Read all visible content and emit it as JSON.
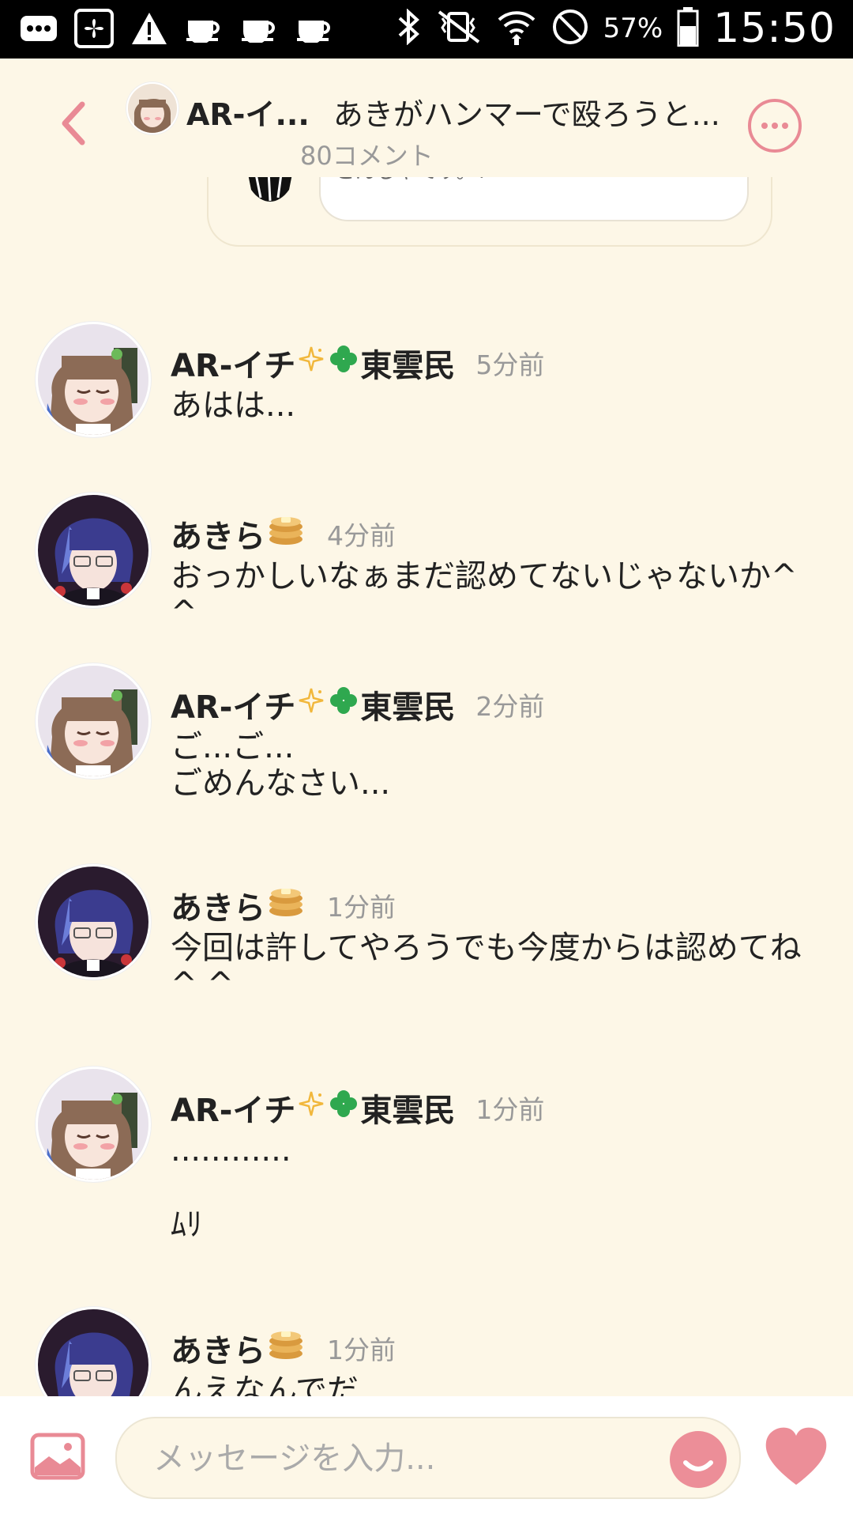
{
  "status_bar": {
    "icons": [
      "more-notification-icon",
      "fan-app-icon",
      "warning-icon",
      "cup-icon",
      "cup-icon",
      "cup-icon",
      "bluetooth-icon",
      "vibrate-icon",
      "wifi-icon",
      "do-not-disturb-icon",
      "battery-icon"
    ],
    "battery_percent": "57%",
    "time": "15:50"
  },
  "header": {
    "user": "AR-イ...",
    "title": "あきがハンマーで殴ろうと...",
    "comment_count": "80コメント"
  },
  "quoted_text": "どんじゃてす。！",
  "comments": [
    {
      "name": "AR-イチ",
      "badges": [
        "✧",
        "✤"
      ],
      "suffix": "東雲民",
      "time": "5分前",
      "body": "あはは..."
    },
    {
      "name": "あきら",
      "badges": [
        "pancake-emoji"
      ],
      "suffix": "",
      "time": "4分前",
      "body": "おっかしいなぁまだ認めてないじゃないか^ ^"
    },
    {
      "name": "AR-イチ",
      "badges": [
        "✧",
        "✤"
      ],
      "suffix": "東雲民",
      "time": "2分前",
      "body": "ご...ご...\nごめんなさい..."
    },
    {
      "name": "あきら",
      "badges": [
        "pancake-emoji"
      ],
      "suffix": "",
      "time": "1分前",
      "body": "今回は許してやろうでも今度からは認めてね\n^ ^"
    },
    {
      "name": "AR-イチ",
      "badges": [
        "✧",
        "✤"
      ],
      "suffix": "東雲民",
      "time": "1分前",
      "body": "............\n\nﾑﾘ"
    },
    {
      "name": "あきら",
      "badges": [
        "pancake-emoji"
      ],
      "suffix": "",
      "time": "1分前",
      "body": "んえなんでだ"
    }
  ],
  "composer": {
    "placeholder": "メッセージを入力..."
  },
  "colors": {
    "background": "#fdf7e7",
    "accent_pink": "#e98a95",
    "badge_green": "#2fa84f",
    "sparkle_gold": "#f1b73b"
  }
}
